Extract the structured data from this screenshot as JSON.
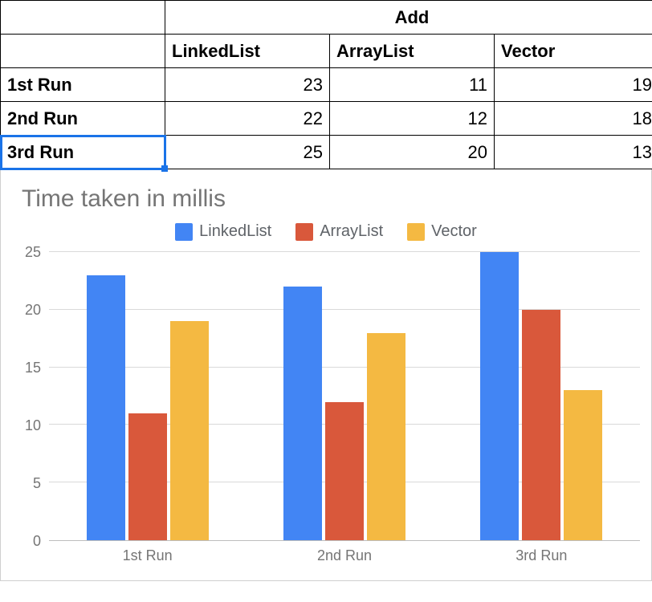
{
  "table": {
    "group_header": "Add",
    "col_headers": [
      "LinkedList",
      "ArrayList",
      "Vector"
    ],
    "rows": [
      {
        "label": "1st Run",
        "values": [
          23,
          11,
          19
        ]
      },
      {
        "label": "2nd Run",
        "values": [
          22,
          12,
          18
        ]
      },
      {
        "label": "3rd Run",
        "values": [
          25,
          20,
          13
        ]
      }
    ],
    "selected_cell": "3rd Run label"
  },
  "chart_data": {
    "type": "bar",
    "title": "Time taken in millis",
    "categories": [
      "1st Run",
      "2nd Run",
      "3rd Run"
    ],
    "series": [
      {
        "name": "LinkedList",
        "color": "#4285f4",
        "values": [
          23,
          22,
          25
        ]
      },
      {
        "name": "ArrayList",
        "color": "#d9583b",
        "values": [
          11,
          12,
          20
        ]
      },
      {
        "name": "Vector",
        "color": "#f4b942",
        "values": [
          19,
          18,
          13
        ]
      }
    ],
    "ylim": [
      0,
      25
    ],
    "yticks": [
      0,
      5,
      10,
      15,
      20,
      25
    ],
    "xlabel": "",
    "ylabel": "",
    "legend_position": "top"
  }
}
